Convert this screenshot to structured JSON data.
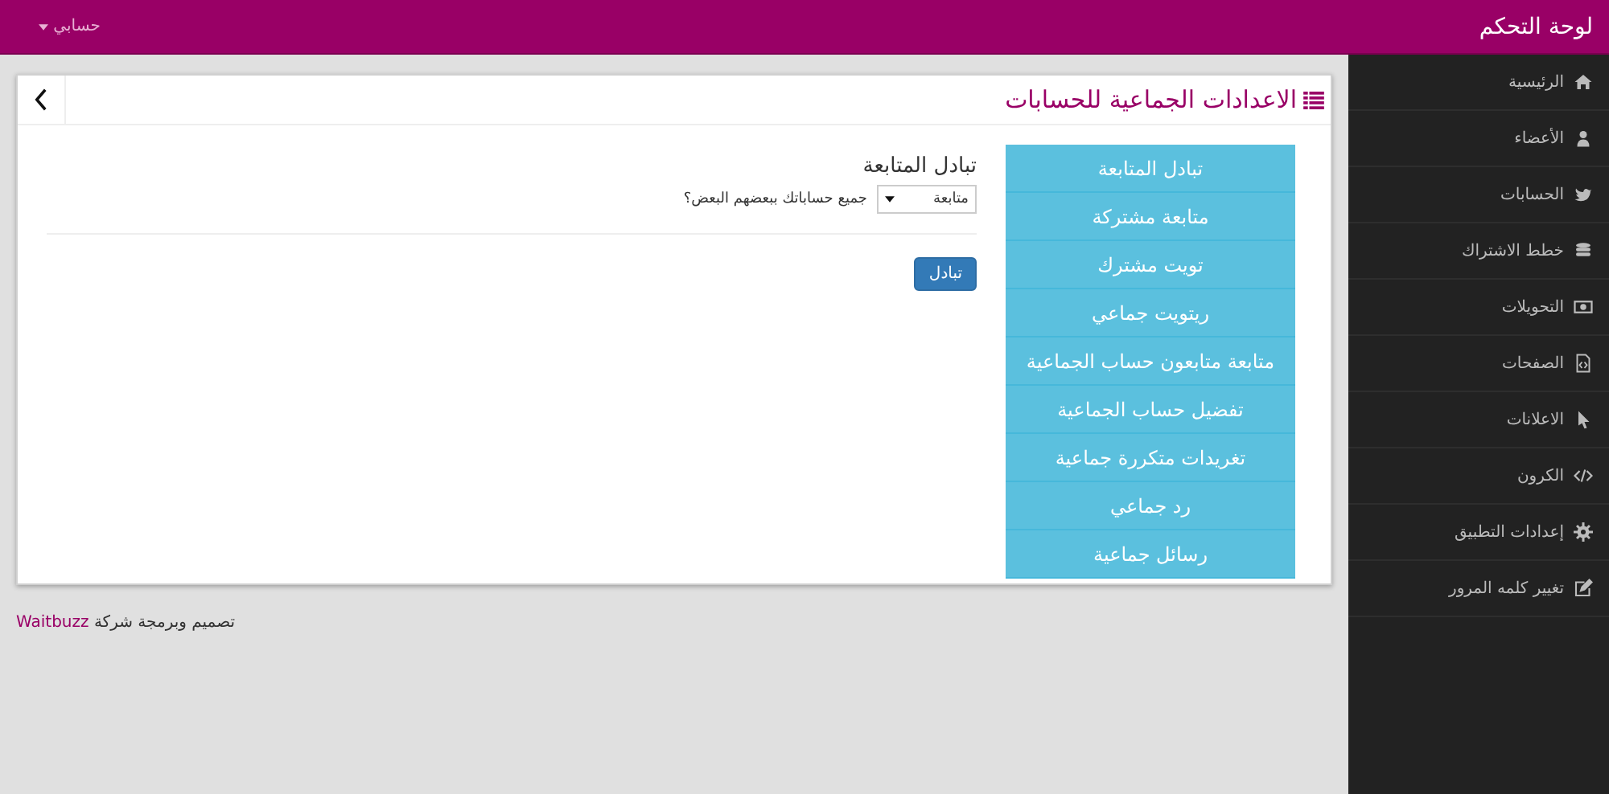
{
  "topbar": {
    "brand": "لوحة التحكم",
    "account_menu": "حسابي"
  },
  "sidebar": {
    "items": [
      {
        "label": "الرئيسية"
      },
      {
        "label": "الأعضاء"
      },
      {
        "label": "الحسابات"
      },
      {
        "label": "خطط الاشتراك"
      },
      {
        "label": "التحويلات"
      },
      {
        "label": "الصفحات"
      },
      {
        "label": "الاعلانات"
      },
      {
        "label": "الكرون"
      },
      {
        "label": "إعدادات التطبيق"
      },
      {
        "label": "تغيير كلمه المرور"
      }
    ]
  },
  "panel": {
    "title": "الاعدادات الجماعية للحسابات",
    "menu": [
      "تبادل المتابعة",
      "متابعة مشتركة",
      "تويت مشترك",
      "ريتويت جماعي",
      "متابعة متابعون حساب الجماعية",
      "تفضيل حساب الجماعية",
      "تغريدات متكررة جماعية",
      "رد جماعي",
      "رسائل جماعية"
    ],
    "form": {
      "heading": "تبادل المتابعة",
      "select_value": "متابعة",
      "question": "جميع حساباتك ببعضهم البعض؟",
      "submit": "تبادل"
    }
  },
  "footer": {
    "text": "تصميم وبرمجة شركة",
    "company": "Waitbuzz"
  }
}
